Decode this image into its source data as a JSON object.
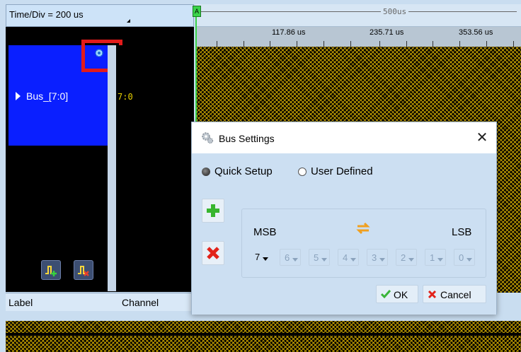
{
  "timebase": {
    "label": "Time/Div = 200 us"
  },
  "ruler": {
    "span_label": "500us",
    "marker_label": "A",
    "ticks": [
      "117.86 us",
      "235.71 us",
      "353.56 us"
    ]
  },
  "bus": {
    "name": "Bus_[7:0]",
    "channel_value": "7:0"
  },
  "panel_footer": {
    "label_col": "Label",
    "channel_col": "Channel"
  },
  "dialog": {
    "title": "Bus Settings",
    "close_glyph": "✕",
    "mode_quick": "Quick Setup",
    "mode_user": "User Defined",
    "selected_mode": "quick",
    "msb_label": "MSB",
    "lsb_label": "LSB",
    "bits": [
      {
        "n": "7",
        "active": true
      },
      {
        "n": "6",
        "active": false
      },
      {
        "n": "5",
        "active": false
      },
      {
        "n": "4",
        "active": false
      },
      {
        "n": "3",
        "active": false
      },
      {
        "n": "2",
        "active": false
      },
      {
        "n": "1",
        "active": false
      },
      {
        "n": "0",
        "active": false
      }
    ],
    "ok_label": "OK",
    "cancel_label": "Cancel"
  },
  "colors": {
    "bus_block": "#0a1fff",
    "waveform": "#c6a100",
    "highlight": "#e21b1b",
    "marker": "#3bd34a"
  },
  "icons": [
    "gear-icon",
    "add-channel-icon",
    "remove-channel-icon",
    "plus-icon",
    "delete-icon",
    "swap-icon",
    "check-icon",
    "cancel-icon",
    "close-icon",
    "settings-icon"
  ]
}
